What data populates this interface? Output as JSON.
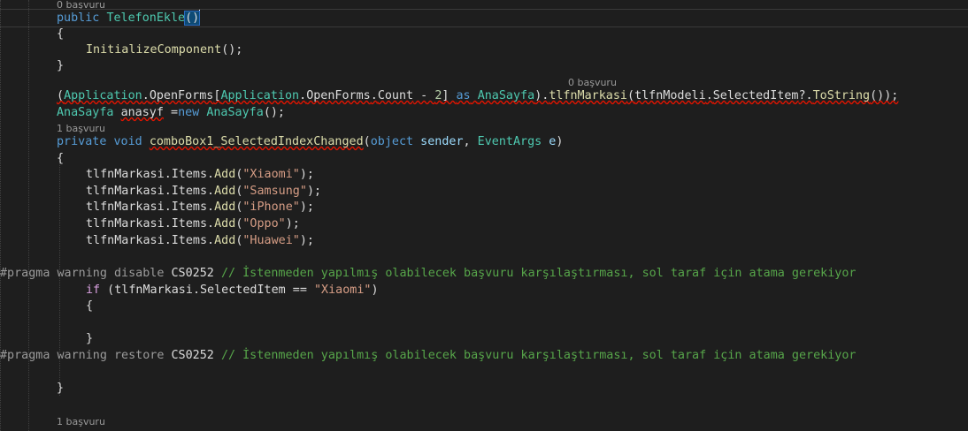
{
  "lens": {
    "ref0_top": "0 başvuru",
    "ref0_mid": "0 başvuru",
    "ref1_combo": "1 başvuru",
    "ref1_bottom": "1 başvuru"
  },
  "code": {
    "l1_kw": "public",
    "l1_name": "TelefonEkle",
    "l1_parens": "()",
    "brace_open": "{",
    "brace_close": "}",
    "l3_call": "InitializeComponent",
    "l3_tail": "();",
    "l6_open": "(",
    "l6_app1": "Application",
    "l6_dot1": ".",
    "l6_openforms1": "OpenForms",
    "l6_br": "[",
    "l6_app2": "Application",
    "l6_dot2": ".",
    "l6_openforms2": "OpenForms",
    "l6_dot3": ".",
    "l6_count": "Count",
    "l6_minus": " - ",
    "l6_two": "2",
    "l6_brclose": "] ",
    "l6_as": "as",
    "l6_space": " ",
    "l6_anasayfa": "AnaSayfa",
    "l6_close": ").",
    "l6_method": "tlfnMarkasi",
    "l6_p": "(",
    "l6_model": "tlfnModeli",
    "l6_dot4": ".",
    "l6_selected": "SelectedItem",
    "l6_q": "?.",
    "l6_tostring": "ToString",
    "l6_end": "());",
    "l7_type": "AnaSayfa",
    "l7_var": "anasyf",
    "l7_eq": " =",
    "l7_new": "new",
    "l7_sp": " ",
    "l7_type2": "AnaSayfa",
    "l7_end": "();",
    "l8_private": "private",
    "l8_void": "void",
    "l8_name": "comboBox1_SelectedIndexChanged",
    "l8_p": "(",
    "l8_object": "object",
    "l8_sender": "sender",
    "l8_comma": ", ",
    "l8_eventargs": "EventArgs",
    "l8_e": "e",
    "l8_end": ")",
    "add_prefix": "tlfnMarkasi",
    "add_mid": ".Items.",
    "add_method": "Add",
    "add_open": "(",
    "add_close": ");",
    "items": [
      "\"Xiaomi\"",
      "\"Samsung\"",
      "\"iPhone\"",
      "\"Oppo\"",
      "\"Huawei\""
    ],
    "pragma_kw": "#pragma",
    "warning": "warning",
    "disable": "disable",
    "restore": "restore",
    "cs": "CS0252",
    "pragma_comment": "// İstenmeden yapılmış olabilecek başvuru karşılaştırması, sol taraf için atama gerekiyor",
    "if_kw": "if",
    "if_open": " (",
    "if_var": "tlfnMarkasi",
    "if_mid": ".SelectedItem == ",
    "if_str": "\"Xiaomi\"",
    "if_close": ")"
  },
  "colors": {
    "background": "#1e1e1e",
    "keyword": "#569cd6",
    "type": "#4ec9b0",
    "method": "#dcdcaa",
    "string": "#d69d85",
    "comment": "#57a64a",
    "error_squiggle": "#e51400"
  }
}
